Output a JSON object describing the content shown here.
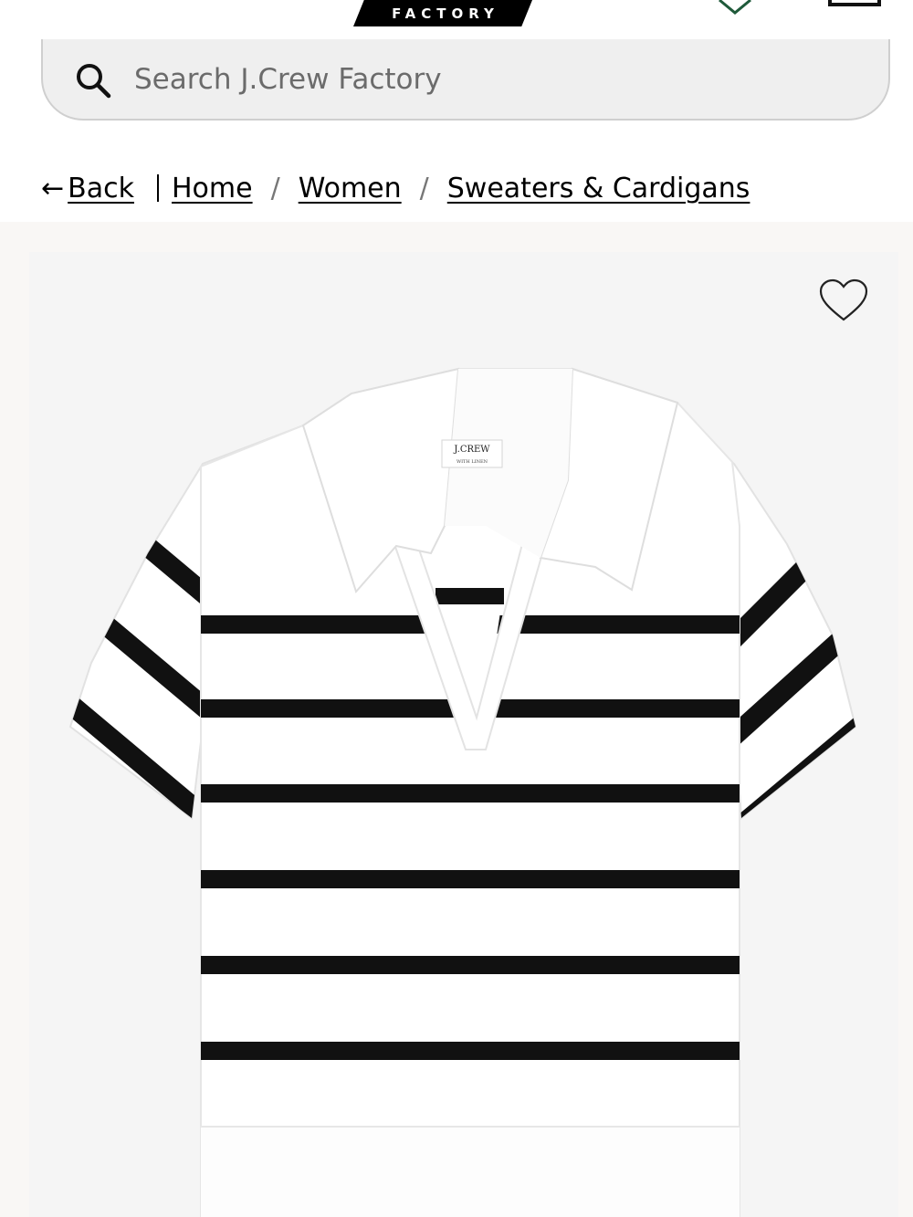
{
  "header": {
    "logo_text": "FACTORY",
    "icons": [
      "shield-icon",
      "shopping-bag-icon"
    ]
  },
  "search": {
    "placeholder": "Search J.Crew Factory",
    "icon": "search-icon"
  },
  "breadcrumb": {
    "back_label": "Back",
    "back_arrow": "←",
    "items": [
      "Home",
      "Women",
      "Sweaters & Cardigans"
    ],
    "separator": "/"
  },
  "product": {
    "wishlist_icon": "heart-icon",
    "image_alt": "White short-sleeve polo sweater with black horizontal stripes",
    "label_brand": "J.CREW",
    "label_sub": "WITH LINEN"
  },
  "colors": {
    "stripe": "#111111",
    "garment": "#ffffff",
    "image_bg": "#f5f5f5",
    "page_bg": "#f9f7f5"
  }
}
